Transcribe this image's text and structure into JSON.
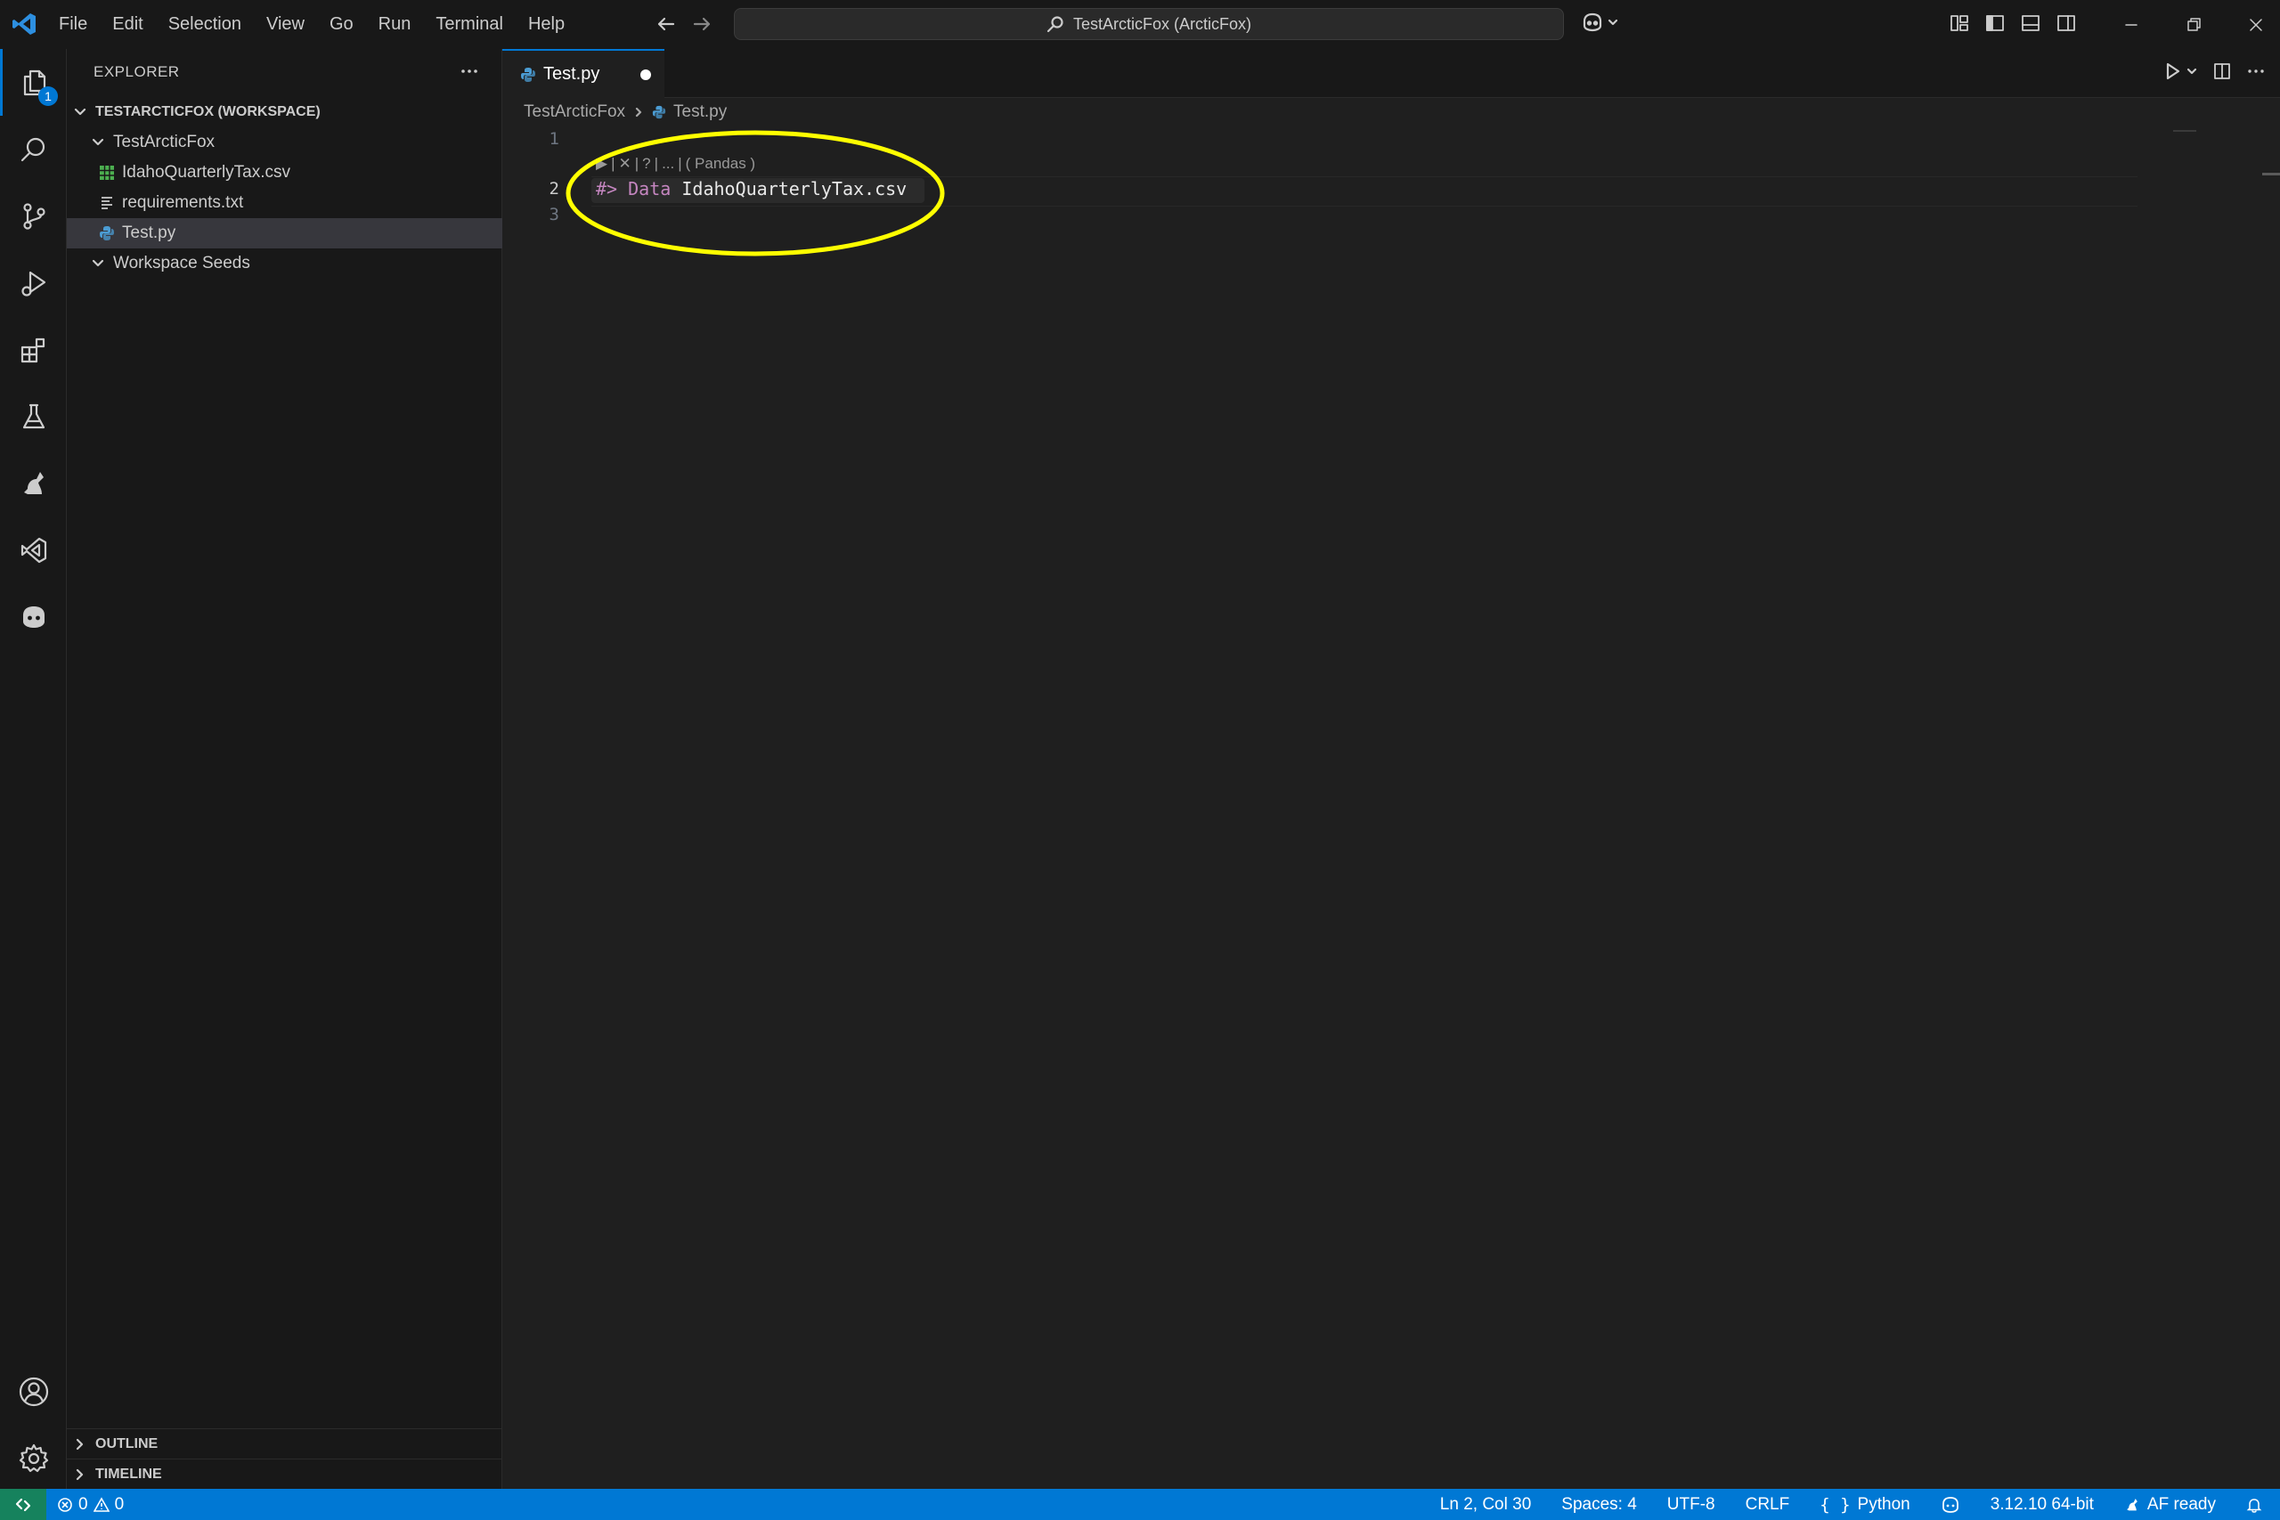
{
  "titlebar": {
    "menus": [
      "File",
      "Edit",
      "Selection",
      "View",
      "Go",
      "Run",
      "Terminal",
      "Help"
    ],
    "command_center": "TestArcticFox (ArcticFox)"
  },
  "activity_bar": {
    "explorer_badge": "1"
  },
  "sidebar": {
    "header": "EXPLORER",
    "workspace": "TESTARCTICFOX (WORKSPACE)",
    "folder": "TestArcticFox",
    "files": [
      {
        "name": "IdahoQuarterlyTax.csv",
        "icon": "csv-table-icon"
      },
      {
        "name": "requirements.txt",
        "icon": "text-lines-icon"
      },
      {
        "name": "Test.py",
        "icon": "python-icon"
      }
    ],
    "second_folder": "Workspace Seeds",
    "outline": "OUTLINE",
    "timeline": "TIMELINE"
  },
  "editor": {
    "tab": "Test.py",
    "breadcrumb": [
      "TestArcticFox",
      "Test.py"
    ],
    "line_numbers": [
      "1",
      "2",
      "3"
    ],
    "codelens": [
      "▶",
      "|",
      "✕",
      "|",
      "?",
      "|",
      "...",
      "|",
      "( Pandas )"
    ],
    "code_line2": {
      "marker": "#>",
      "keyword": "Data",
      "arg": "IdahoQuarterlyTax.csv"
    }
  },
  "colors": {
    "accent": "#0078d4",
    "annotation": "#ffff00",
    "marker": "#c586c0",
    "keyword": "#c586c0",
    "csv": "#4caf50",
    "python": "#4b9cd3"
  },
  "statusbar": {
    "errors": "0",
    "warnings": "0",
    "position": "Ln 2, Col 30",
    "spaces": "Spaces: 4",
    "encoding": "UTF-8",
    "eol": "CRLF",
    "language": "Python",
    "interpreter": "3.12.10 64-bit",
    "af_status": "AF ready"
  }
}
